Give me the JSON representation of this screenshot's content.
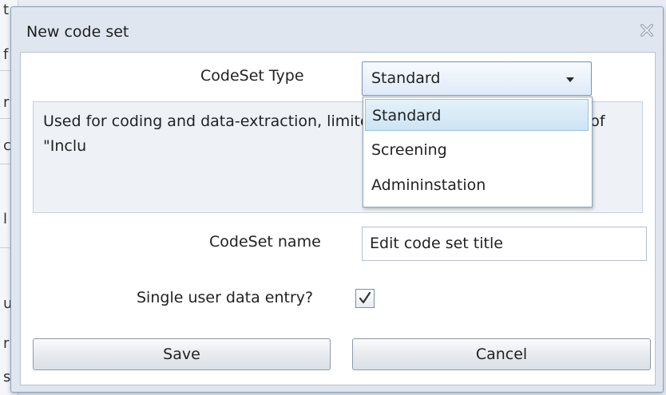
{
  "background": {
    "glyphs": [
      "t",
      "f",
      "r",
      "c",
      "l",
      "u",
      "r",
      "s"
    ]
  },
  "dialog": {
    "title": "New code set",
    "close_icon": "close-icon"
  },
  "form": {
    "codeset_type_label": "CodeSet Type",
    "codeset_type_value": "Standard",
    "description": "Used for coding and data-extraction, limited depth, can't contain codes of \"Inclu",
    "description_tail": "imited",
    "dropdown_options": [
      "Standard",
      "Screening",
      "Admininstation"
    ],
    "dropdown_selected_index": 0,
    "codeset_name_label": "CodeSet name",
    "codeset_name_value": "Edit code set title",
    "single_user_label": "Single user data entry?",
    "single_user_checked": true
  },
  "buttons": {
    "save": "Save",
    "cancel": "Cancel"
  },
  "colors": {
    "accent_border": "#6f94c1",
    "selected_item": "#cde4f3",
    "dialog_chrome": "#dfe6ef"
  }
}
